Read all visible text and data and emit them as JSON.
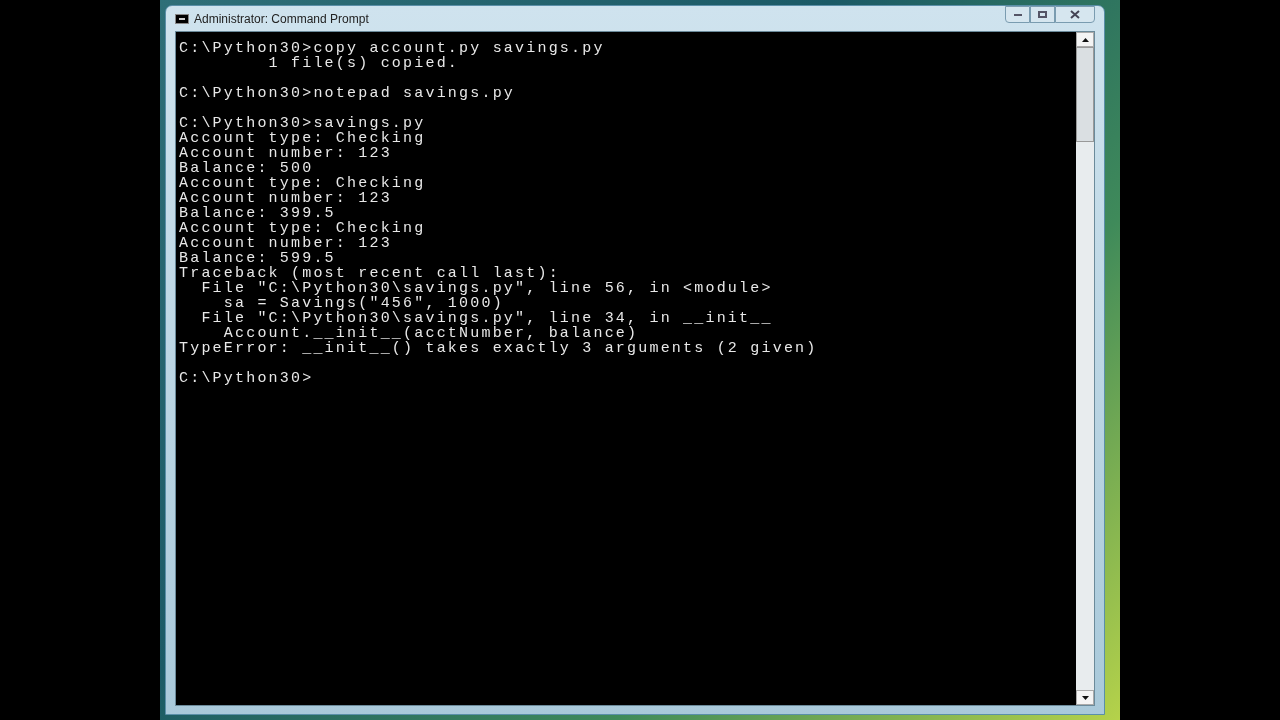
{
  "window": {
    "title": "Administrator: Command Prompt"
  },
  "console": {
    "blocks": [
      [
        "C:\\Python30>copy account.py savings.py",
        "        1 file(s) copied."
      ],
      [
        "C:\\Python30>notepad savings.py"
      ],
      [
        "C:\\Python30>savings.py",
        "Account type: Checking",
        "Account number: 123",
        "Balance: 500",
        "Account type: Checking",
        "Account number: 123",
        "Balance: 399.5",
        "Account type: Checking",
        "Account number: 123",
        "Balance: 599.5",
        "Traceback (most recent call last):",
        "  File \"C:\\Python30\\savings.py\", line 56, in <module>",
        "    sa = Savings(\"456\", 1000)",
        "  File \"C:\\Python30\\savings.py\", line 34, in __init__",
        "    Account.__init__(acctNumber, balance)",
        "TypeError: __init__() takes exactly 3 arguments (2 given)"
      ],
      [
        "C:\\Python30>"
      ]
    ]
  }
}
